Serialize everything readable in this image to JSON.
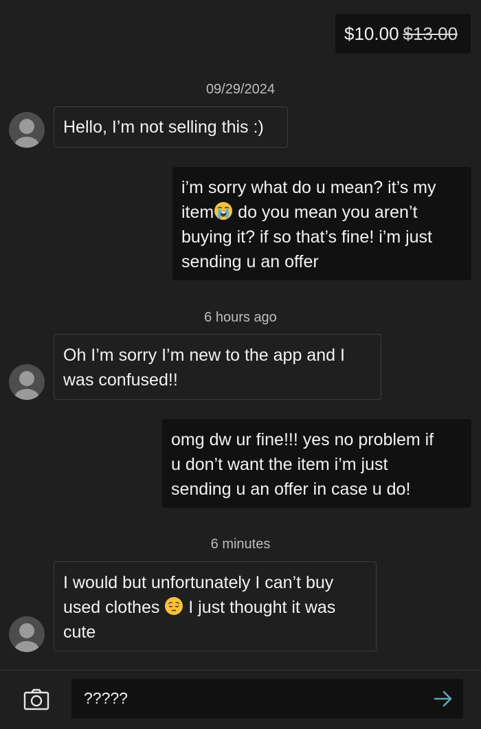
{
  "offer": {
    "price": "$10.00",
    "original_price": "$13.00"
  },
  "messages": [
    {
      "date": "09/29/2024"
    },
    {
      "text": "Hello, I’m not selling this :)"
    },
    {
      "line1": "i’m sorry what do u mean? it’s my",
      "line2_before_emoji": "item",
      "emoji": "loudly-crying-face",
      "line2_after_emoji": " do you mean you aren’t",
      "line3": "buying it? if so that’s fine! i’m just",
      "line4": "sending u an offer"
    },
    {
      "date": "6 hours ago"
    },
    {
      "line1": "Oh I’m sorry I’m new to the app and I",
      "line2": "was confused!!"
    },
    {
      "line1": "omg dw ur fine!!! yes no problem if",
      "line2": "u don’t want the item i’m just",
      "line3": "sending u an offer in case u do!"
    },
    {
      "date": "6 minutes"
    },
    {
      "line1": "I would but unfortunately I can’t buy",
      "line2_before_emoji": "used clothes ",
      "emoji": "pensive-face",
      "line2_after_emoji": " I just thought it was",
      "line3": "cute"
    }
  ],
  "composer": {
    "input_value": "?????",
    "camera_icon": "camera-icon",
    "send_icon": "send-arrow-icon"
  },
  "colors": {
    "background": "#1f1f1f",
    "outgoing_bubble": "#111111",
    "send_arrow": "#5fa8b5"
  }
}
